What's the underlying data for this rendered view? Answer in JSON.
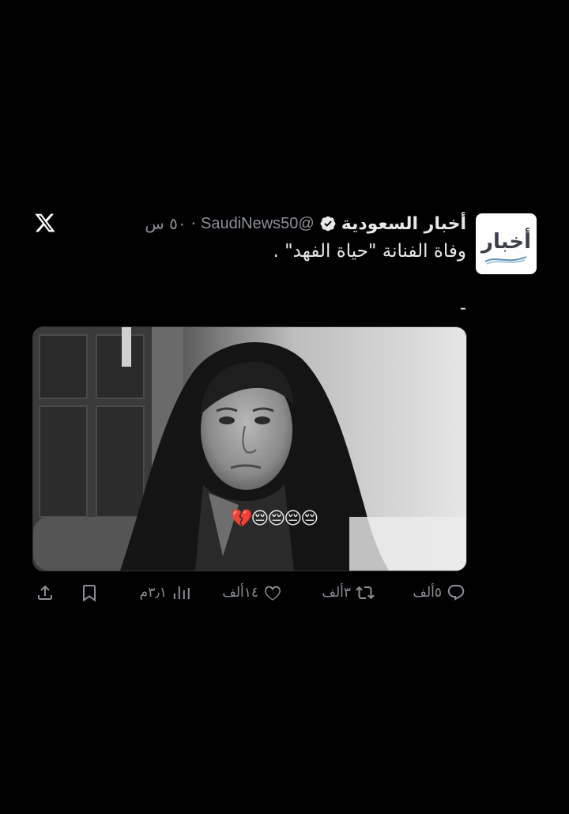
{
  "tweet": {
    "author_name": "أخبار السعودية",
    "handle": "@SaudiNews50",
    "separator": "·",
    "time": "٥٠ س",
    "text": "وفاة الفنانة \"حياة الفهد\" .\n\n-",
    "avatar_text": "أخبار",
    "media_caption": "💔😔😔😔😔"
  },
  "actions": {
    "replies": "٥ألف",
    "retweets": "٣ألف",
    "likes": "١٤ألف",
    "views": "٣٫١م"
  },
  "colors": {
    "background": "#000000",
    "text": "#e7e9ea",
    "muted": "#8b9096",
    "verified": "#e7e9ea"
  }
}
